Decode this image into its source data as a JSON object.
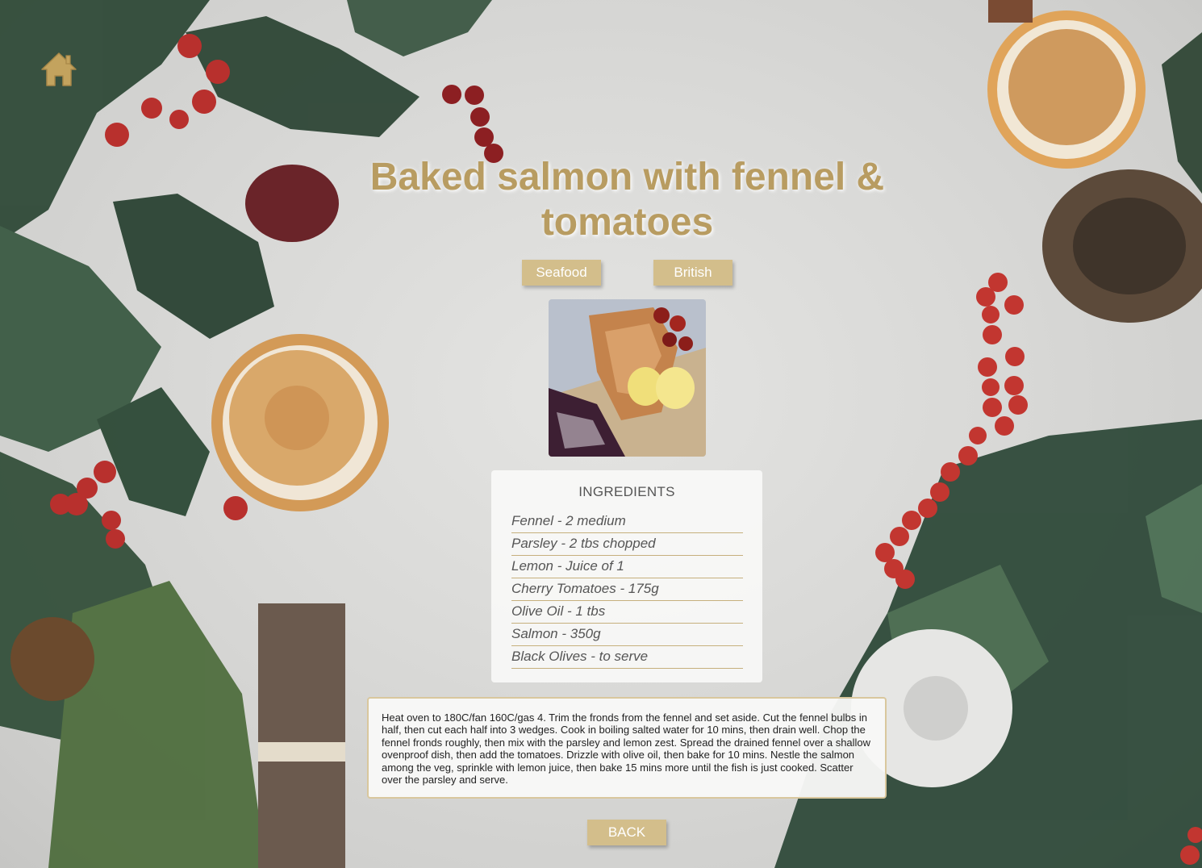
{
  "recipe": {
    "title": "Baked salmon with fennel & tomatoes",
    "tags": [
      "Seafood",
      "British"
    ],
    "ingredients_heading": "INGREDIENTS",
    "ingredients": [
      "Fennel - 2 medium",
      "Parsley - 2 tbs chopped",
      "Lemon - Juice of 1",
      "Cherry Tomatoes - 175g",
      "Olive Oil - 1 tbs",
      "Salmon - 350g",
      "Black Olives - to serve"
    ],
    "method": "Heat oven to 180C/fan 160C/gas 4. Trim the fronds from the fennel and set aside. Cut the fennel bulbs in half, then cut each half into 3 wedges. Cook in boiling salted water for 10 mins, then drain well. Chop the fennel fronds roughly, then mix with the parsley and lemon zest. Spread the drained fennel over a shallow ovenproof dish, then add the tomatoes. Drizzle with olive oil, then bake for 10 mins. Nestle the salmon among the veg, sprinkle with lemon juice, then bake 15 mins more until the fish is just cooked. Scatter over the parsley and serve."
  },
  "nav": {
    "back_label": "BACK",
    "home_icon": "home-icon"
  },
  "colors": {
    "accent": "#d3be8b",
    "title": "#b89c61",
    "rule": "#c6b07d"
  }
}
